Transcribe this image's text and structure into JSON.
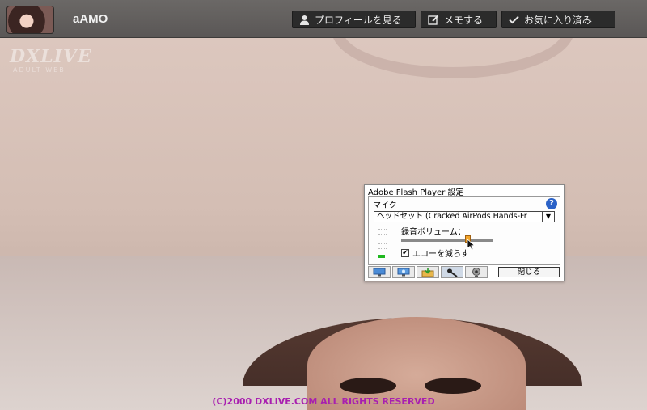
{
  "header": {
    "username": "aAMO",
    "buttons": {
      "profile": "プロフィールを見る",
      "memo": "メモする",
      "favorite": "お気に入り済み"
    }
  },
  "video": {
    "watermark": "DXLIVE",
    "watermark_sub": "ADULT WEB",
    "copyright": "(C)2000 DXLIVE.COM ALL RIGHTS RESERVED"
  },
  "flash_dialog": {
    "title": "Adobe Flash Player 設定",
    "section": "マイク",
    "help": "?",
    "device": "ヘッドセット (Cracked  AirPods Hands-Fr",
    "volume_label": "録音ボリューム：",
    "volume_level": 0.74,
    "echo_label": "エコーを減らす",
    "echo_checked": "✔",
    "close_label": "閉じる",
    "tabs": [
      "privacy",
      "local-storage",
      "record",
      "microphone",
      "camera"
    ],
    "active_tab": "microphone"
  },
  "colors": {
    "topbar": "#5f5c5b",
    "button_bg": "#2b2b2b",
    "copyright": "#a81fb0",
    "level_meter": "#1fb81f",
    "slider_thumb": "#f2a52a"
  }
}
